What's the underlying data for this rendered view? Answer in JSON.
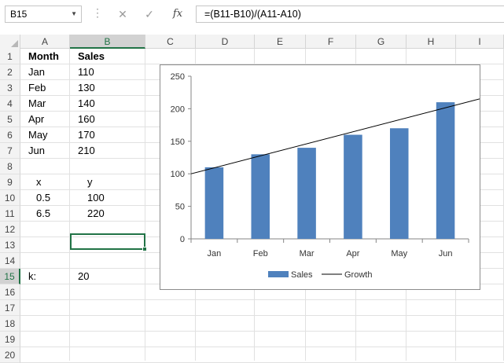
{
  "formula_bar": {
    "name_box": "B15",
    "cancel_icon": "✕",
    "enter_icon": "✓",
    "fx_label": "fx",
    "formula": "=(B11-B10)/(A11-A10)"
  },
  "grid": {
    "columns": [
      "A",
      "B",
      "C",
      "D",
      "E",
      "F",
      "G",
      "H",
      "I"
    ],
    "selected_column": "B",
    "rows": [
      "1",
      "2",
      "3",
      "4",
      "5",
      "6",
      "7",
      "8",
      "9",
      "10",
      "11",
      "12",
      "13",
      "14",
      "15",
      "16",
      "17",
      "18",
      "19",
      "20"
    ],
    "selected_row": "15",
    "cells": {
      "A1": "Month",
      "B1": "Sales",
      "A2": "Jan",
      "B2": "110",
      "A3": "Feb",
      "B3": "130",
      "A4": "Mar",
      "B4": "140",
      "A5": "Apr",
      "B5": "160",
      "A6": "May",
      "B6": "170",
      "A7": "Jun",
      "B7": "210",
      "A9": "x",
      "B9": "y",
      "A10": "0.5",
      "B10": "100",
      "A11": "6.5",
      "B11": "220",
      "A15": "k:",
      "B15": "20"
    }
  },
  "chart_data": {
    "type": "bar",
    "categories": [
      "Jan",
      "Feb",
      "Mar",
      "Apr",
      "May",
      "Jun"
    ],
    "series": [
      {
        "name": "Sales",
        "type": "bar",
        "values": [
          110,
          130,
          140,
          160,
          170,
          210
        ],
        "color": "#4f81bd"
      },
      {
        "name": "Growth",
        "type": "line",
        "x": [
          0,
          6.5
        ],
        "y": [
          100,
          220
        ],
        "color": "#000000"
      }
    ],
    "ylim": [
      0,
      250
    ],
    "yticks": [
      0,
      50,
      100,
      150,
      200,
      250
    ],
    "grid": false,
    "legend_position": "bottom"
  }
}
